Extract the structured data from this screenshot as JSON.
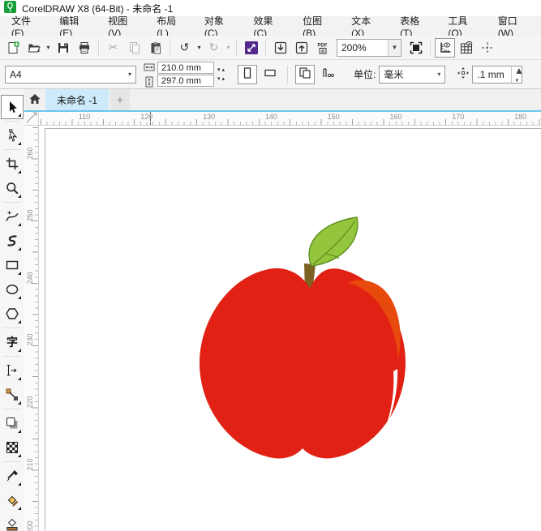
{
  "window": {
    "title": "CorelDRAW X8 (64-Bit) - 未命名 -1"
  },
  "menu_bar": {
    "items": [
      "文件(F)",
      "编辑(E)",
      "视图(V)",
      "布局(L)",
      "对象(C)",
      "效果(C)",
      "位图(B)",
      "文本(X)",
      "表格(T)",
      "工具(O)",
      "窗口(W)"
    ]
  },
  "toolbar": {
    "zoom_level": "200%",
    "items": [
      {
        "type": "button",
        "name": "new-document-button",
        "icon": "new-document-icon"
      },
      {
        "type": "button",
        "name": "open-button",
        "icon": "open-folder-icon",
        "dropdown": true
      },
      {
        "type": "button",
        "name": "save-button",
        "icon": "save-icon"
      },
      {
        "type": "button",
        "name": "print-button",
        "icon": "print-icon"
      },
      {
        "type": "separator"
      },
      {
        "type": "button",
        "name": "cut-button",
        "icon": "cut-icon",
        "disabled": true
      },
      {
        "type": "button",
        "name": "copy-button",
        "icon": "copy-icon",
        "disabled": true
      },
      {
        "type": "button",
        "name": "paste-button",
        "icon": "paste-icon"
      },
      {
        "type": "separator"
      },
      {
        "type": "button",
        "name": "undo-button",
        "icon": "undo-icon",
        "dropdown": true
      },
      {
        "type": "button",
        "name": "redo-button",
        "icon": "redo-icon",
        "disabled": true,
        "dropdown": true
      },
      {
        "type": "separator"
      },
      {
        "type": "button",
        "name": "search-content-button",
        "icon": "search-content-icon"
      },
      {
        "type": "separator"
      },
      {
        "type": "button",
        "name": "import-button",
        "icon": "import-icon"
      },
      {
        "type": "button",
        "name": "export-button",
        "icon": "export-icon"
      },
      {
        "type": "button",
        "name": "pdf-button",
        "icon": "publish-pdf-icon"
      },
      {
        "type": "zoom-select",
        "name": "zoom-level-select"
      },
      {
        "type": "button",
        "name": "fullscreen-preview-button",
        "icon": "fullscreen-preview-icon"
      },
      {
        "type": "separator"
      },
      {
        "type": "button",
        "name": "show-rulers-button",
        "icon": "rulers-icon",
        "pressed": true
      },
      {
        "type": "button",
        "name": "show-grid-button",
        "icon": "grid-icon"
      },
      {
        "type": "button",
        "name": "show-guidelines-button",
        "icon": "guidelines-icon"
      }
    ]
  },
  "property_bar": {
    "page_size_preset": "A4",
    "page_width": "210.0 mm",
    "page_height": "297.0 mm",
    "units_label": "单位:",
    "units_value": "毫米",
    "nudge_offset": ".1 mm"
  },
  "document_tabs": {
    "active_tab": "未命名 -1",
    "new_tab_label": "+"
  },
  "rulers": {
    "horizontal_labels": [
      "110",
      "120",
      "130",
      "140",
      "150",
      "160",
      "170",
      "180"
    ],
    "vertical_labels": [
      "260",
      "250",
      "240",
      "230",
      "220",
      "210",
      "200"
    ]
  },
  "toolbox": {
    "tools": [
      {
        "name": "pick-tool",
        "icon": "pick-cursor-icon",
        "selected": true
      },
      {
        "name": "shape-tool",
        "icon": "shape-node-icon",
        "group_start": true
      },
      {
        "name": "crop-tool",
        "icon": "crop-icon",
        "group_start": true
      },
      {
        "name": "zoom-tool",
        "icon": "zoom-magnifier-icon"
      },
      {
        "name": "freehand-tool",
        "icon": "freehand-curve-icon",
        "group_start": true
      },
      {
        "name": "smart-drawing-tool",
        "icon": "smart-drawing-icon"
      },
      {
        "name": "rectangle-tool",
        "icon": "rectangle-icon"
      },
      {
        "name": "ellipse-tool",
        "icon": "ellipse-icon"
      },
      {
        "name": "polygon-tool",
        "icon": "polygon-icon"
      },
      {
        "name": "text-tool",
        "icon": "text-icon",
        "label": "字",
        "group_start": true
      },
      {
        "name": "parallel-dimension-tool",
        "icon": "dimension-icon",
        "group_start": true
      },
      {
        "name": "connector-tool",
        "icon": "connector-icon"
      },
      {
        "name": "drop-shadow-tool",
        "icon": "drop-shadow-icon",
        "group_start": true
      },
      {
        "name": "transparency-tool",
        "icon": "transparency-icon"
      },
      {
        "name": "color-eyedropper-tool",
        "icon": "eyedropper-icon",
        "group_start": true
      },
      {
        "name": "smart-fill-tool",
        "icon": "smart-fill-icon"
      },
      {
        "name": "interactive-fill-tool",
        "icon": "interactive-fill-icon"
      }
    ]
  },
  "canvas": {
    "artwork": "red-apple-with-green-leaf",
    "colors": {
      "apple_body": "#e02113",
      "apple_highlight": "#e8490c",
      "apple_shine": "#ffffff",
      "leaf_fill": "#93c63c",
      "leaf_outline": "#5f8f1d",
      "stem": "#7c6222"
    }
  }
}
